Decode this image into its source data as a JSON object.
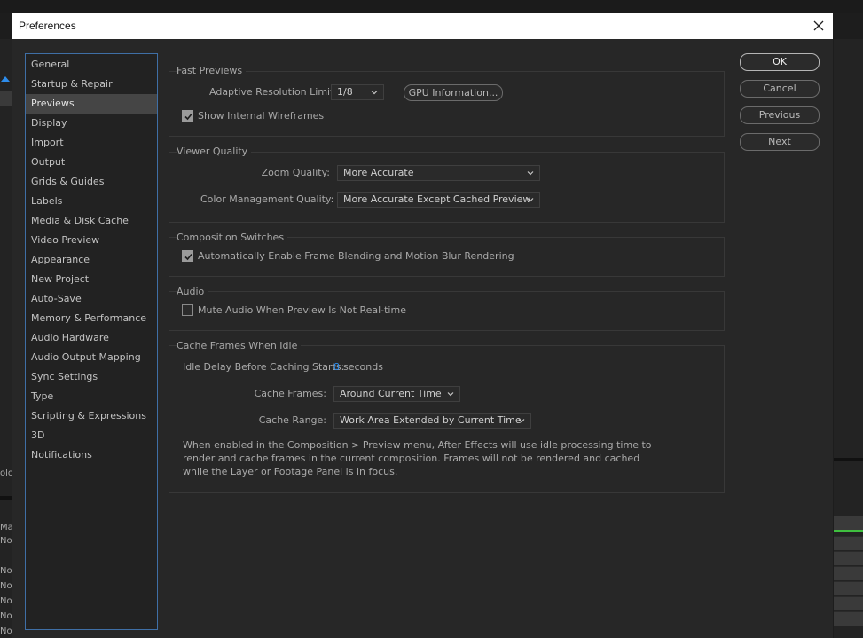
{
  "window": {
    "title": "Preferences"
  },
  "sidebar": {
    "items": [
      {
        "label": "General"
      },
      {
        "label": "Startup & Repair"
      },
      {
        "label": "Previews"
      },
      {
        "label": "Display"
      },
      {
        "label": "Import"
      },
      {
        "label": "Output"
      },
      {
        "label": "Grids & Guides"
      },
      {
        "label": "Labels"
      },
      {
        "label": "Media & Disk Cache"
      },
      {
        "label": "Video Preview"
      },
      {
        "label": "Appearance"
      },
      {
        "label": "New Project"
      },
      {
        "label": "Auto-Save"
      },
      {
        "label": "Memory & Performance"
      },
      {
        "label": "Audio Hardware"
      },
      {
        "label": "Audio Output Mapping"
      },
      {
        "label": "Sync Settings"
      },
      {
        "label": "Type"
      },
      {
        "label": "Scripting & Expressions"
      },
      {
        "label": "3D"
      },
      {
        "label": "Notifications"
      }
    ],
    "selected": "Previews"
  },
  "fast_previews": {
    "title": "Fast Previews",
    "adaptive_label": "Adaptive Resolution Limit:",
    "adaptive_value": "1/8",
    "gpu_button": "GPU Information...",
    "wireframes_label": "Show Internal Wireframes",
    "wireframes_checked": true
  },
  "viewer_quality": {
    "title": "Viewer Quality",
    "zoom_label": "Zoom Quality:",
    "zoom_value": "More Accurate",
    "color_label": "Color Management Quality:",
    "color_value": "More Accurate Except Cached Preview"
  },
  "composition_switches": {
    "title": "Composition Switches",
    "frame_blend_label": "Automatically Enable Frame Blending and Motion Blur Rendering",
    "frame_blend_checked": true
  },
  "audio": {
    "title": "Audio",
    "mute_label": "Mute Audio When Preview Is Not Real-time",
    "mute_checked": false
  },
  "cache_idle": {
    "title": "Cache Frames When Idle",
    "delay_label": "Idle Delay Before Caching Starts:",
    "delay_value": "8",
    "delay_unit": "seconds",
    "frames_label": "Cache Frames:",
    "frames_value": "Around Current Time",
    "range_label": "Cache Range:",
    "range_value": "Work Area Extended by Current Time",
    "note": "When enabled in the Composition > Preview menu, After Effects will use idle processing time to render and cache frames in the current composition. Frames will not be rendered and cached while the Layer or Footage Panel is in focus."
  },
  "buttons": {
    "ok": "OK",
    "cancel": "Cancel",
    "previous": "Previous",
    "next": "Next"
  },
  "background_app": {
    "left_fragments": [
      "olo",
      "Ma",
      "No",
      "No",
      "No",
      "No",
      "No",
      "No"
    ]
  },
  "colors": {
    "accent": "#2d8ceb",
    "sidebar_border": "#3f6fa6",
    "dialog_bg": "#272727",
    "selected_item_bg": "#454545",
    "progress_green": "#3fbf3f"
  }
}
